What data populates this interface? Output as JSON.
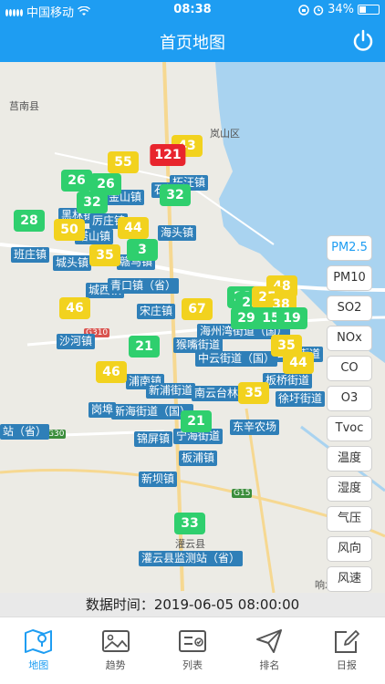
{
  "status_bar": {
    "carrier": "中国移动",
    "time": "08:38",
    "battery": "34%"
  },
  "header": {
    "title": "首页地图",
    "power_icon": "power-icon"
  },
  "map": {
    "place_labels": [
      {
        "text": "莒南县"
      },
      {
        "text": "岚山区"
      },
      {
        "text": "G310"
      },
      {
        "text": "G30"
      },
      {
        "text": "G15"
      },
      {
        "text": "灌云县"
      },
      {
        "text": "响水"
      }
    ],
    "markers": [
      {
        "value": "43",
        "level": "yellow"
      },
      {
        "value": "121",
        "level": "red"
      },
      {
        "value": "55",
        "level": "yellow"
      },
      {
        "value": "26",
        "level": "green"
      },
      {
        "value": "26",
        "level": "green"
      },
      {
        "value": "32",
        "level": "green"
      },
      {
        "value": "32",
        "level": "green"
      },
      {
        "value": "28",
        "level": "green"
      },
      {
        "value": "50",
        "level": "yellow"
      },
      {
        "value": "44",
        "level": "yellow"
      },
      {
        "value": "35",
        "level": "yellow"
      },
      {
        "value": "3",
        "level": "green"
      },
      {
        "value": "46",
        "level": "yellow"
      },
      {
        "value": "67",
        "level": "yellow"
      },
      {
        "value": "48",
        "level": "yellow"
      },
      {
        "value": "28",
        "level": "green"
      },
      {
        "value": "22",
        "level": "green"
      },
      {
        "value": "25",
        "level": "yellow"
      },
      {
        "value": "38",
        "level": "yellow"
      },
      {
        "value": "29",
        "level": "green"
      },
      {
        "value": "15",
        "level": "green"
      },
      {
        "value": "19",
        "level": "green"
      },
      {
        "value": "35",
        "level": "yellow"
      },
      {
        "value": "21",
        "level": "green"
      },
      {
        "value": "46",
        "level": "yellow"
      },
      {
        "value": "44",
        "level": "yellow"
      },
      {
        "value": "35",
        "level": "yellow"
      },
      {
        "value": "21",
        "level": "green"
      },
      {
        "value": "33",
        "level": "green"
      }
    ],
    "stations": [
      {
        "text": "柘汪镇"
      },
      {
        "text": "石桥镇"
      },
      {
        "text": "金山镇"
      },
      {
        "text": "黑林镇"
      },
      {
        "text": "厉庄镇"
      },
      {
        "text": "塔山镇"
      },
      {
        "text": "海头镇"
      },
      {
        "text": "班庄镇"
      },
      {
        "text": "城头镇"
      },
      {
        "text": "赣马镇"
      },
      {
        "text": "城西镇"
      },
      {
        "text": "青口镇（省）"
      },
      {
        "text": "宋庄镇"
      },
      {
        "text": "沙河镇"
      },
      {
        "text": "海州湾街道（国）"
      },
      {
        "text": "猴嘴街道"
      },
      {
        "text": "中云街道（国）"
      },
      {
        "text": "公益街道"
      },
      {
        "text": "板桥街道"
      },
      {
        "text": "徐圩街道"
      },
      {
        "text": "浦南镇"
      },
      {
        "text": "新浦街道"
      },
      {
        "text": "南云台林场"
      },
      {
        "text": "新海街道（国）"
      },
      {
        "text": "岗埠"
      },
      {
        "text": "锦屏镇"
      },
      {
        "text": "宁海街道"
      },
      {
        "text": "东辛农场"
      },
      {
        "text": "板浦镇"
      },
      {
        "text": "新坝镇"
      },
      {
        "text": "灌云县监测站（省）"
      },
      {
        "text": "站（省）"
      }
    ]
  },
  "layers": {
    "items": [
      "PM2.5",
      "PM10",
      "SO2",
      "NOx",
      "CO",
      "O3",
      "Tvoc",
      "温度",
      "湿度",
      "气压",
      "风向",
      "风速"
    ],
    "active": "PM2.5"
  },
  "time_bar": {
    "text": "数据时间：2019-06-05 08:00:00"
  },
  "tabs": [
    {
      "label": "地图",
      "icon": "map-icon"
    },
    {
      "label": "趋势",
      "icon": "image-icon"
    },
    {
      "label": "列表",
      "icon": "list-icon"
    },
    {
      "label": "排名",
      "icon": "send-icon"
    },
    {
      "label": "日报",
      "icon": "edit-icon"
    }
  ],
  "colors": {
    "primary": "#1e9df2",
    "green": "#2fcf6e",
    "yellow": "#f2d21e",
    "red": "#e8252d",
    "station": "#2f7fb8"
  }
}
